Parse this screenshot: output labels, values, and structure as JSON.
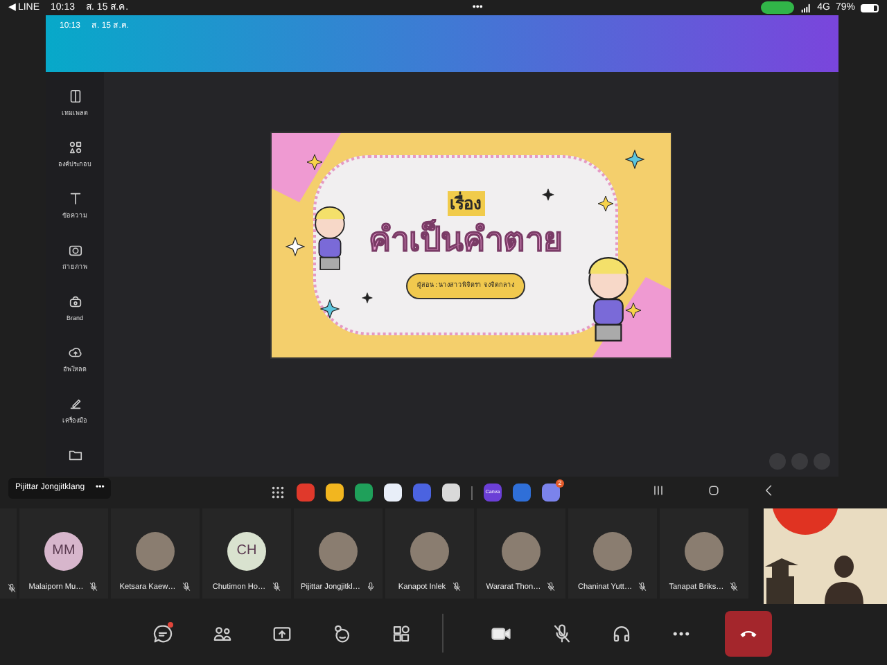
{
  "status_bar": {
    "back": "◀ LINE",
    "time": "10:13",
    "date": "ส. 15 ส.ค.",
    "dots": "•••",
    "network": "4G",
    "battery": "79%"
  },
  "tablet_status": {
    "time": "10:13",
    "date": "ส. 15 ส.ค."
  },
  "editor_sidebar": {
    "items": [
      {
        "kind": "template",
        "label": "เทมเพลต"
      },
      {
        "kind": "elements",
        "label": "องค์ประกอบ"
      },
      {
        "kind": "text",
        "label": "ข้อความ"
      },
      {
        "kind": "camera",
        "label": "ถ่ายภาพ"
      },
      {
        "kind": "brand",
        "label": "Brand"
      },
      {
        "kind": "upload",
        "label": "อัพโหลด"
      },
      {
        "kind": "tools",
        "label": "เครื่องมือ"
      },
      {
        "kind": "folder"
      }
    ]
  },
  "slide": {
    "heading": "เรื่อง",
    "title": "คำเป็นคำตาย",
    "presenter": "ผู้สอน : นางสาวพิจิตรา จงจิตกลาง"
  },
  "presenter_tag": {
    "name": "Pijittar Jongjitklang",
    "more": "•••"
  },
  "dock": {
    "apps": [
      {
        "kind": "grid"
      },
      {
        "kind": "app",
        "color": "#e0392b"
      },
      {
        "kind": "app",
        "color": "#f2b61f"
      },
      {
        "kind": "app",
        "color": "#1fa05a"
      },
      {
        "kind": "app",
        "color": "#e8eef8"
      },
      {
        "kind": "app",
        "color": "#4b63e0"
      },
      {
        "kind": "app",
        "color": "#d9d9d9"
      },
      {
        "kind": "divider"
      },
      {
        "kind": "labeled",
        "color": "#6b3fd6",
        "label": "Canva"
      },
      {
        "kind": "app",
        "color": "#2f6fd8"
      },
      {
        "kind": "app",
        "color": "#7b83eb",
        "badge": "2"
      }
    ]
  },
  "participants": [
    {
      "muted": true
    },
    {
      "name": "Malaiporn Mu…",
      "initials": "MM",
      "color": "#d7b6cc",
      "muted": true
    },
    {
      "name": "Ketsara Kaew…",
      "muted": true
    },
    {
      "name": "Chutimon Ho…",
      "initials": "CH",
      "color": "#d9e2cf",
      "muted": true
    },
    {
      "name": "Pijittar Jongjitkl…",
      "muted": false
    },
    {
      "name": "Kanapot Inlek",
      "muted": true
    },
    {
      "name": "Wararat Thon…",
      "muted": true
    },
    {
      "name": "Chaninat Yutt…",
      "muted": true
    },
    {
      "name": "Tanapat Briks…",
      "muted": true
    }
  ],
  "toolbar": [
    {
      "kind": "chat",
      "badge": true
    },
    {
      "kind": "people"
    },
    {
      "kind": "share"
    },
    {
      "kind": "react"
    },
    {
      "kind": "apps"
    },
    {
      "kind": "divider"
    },
    {
      "kind": "camera"
    },
    {
      "kind": "mic",
      "muted": true
    },
    {
      "kind": "audio"
    },
    {
      "kind": "more"
    },
    {
      "kind": "hangup"
    }
  ]
}
